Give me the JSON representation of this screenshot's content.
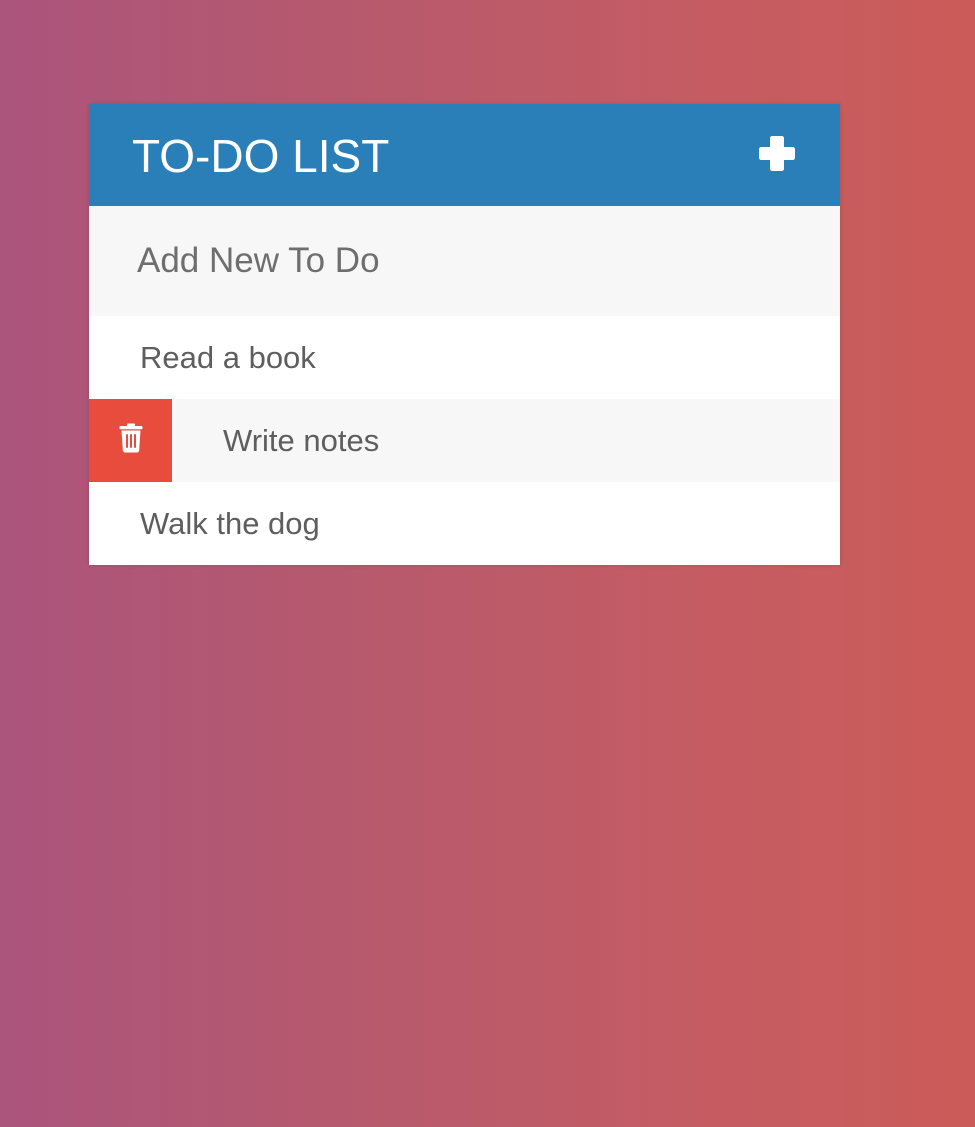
{
  "header": {
    "title": "TO-DO LIST",
    "add_icon": "plus-icon"
  },
  "new_todo": {
    "placeholder": "Add New To Do",
    "value": ""
  },
  "todos": [
    {
      "text": "Read a book",
      "delete_revealed": false
    },
    {
      "text": "Write notes",
      "delete_revealed": true,
      "delete_icon": "trash-icon"
    },
    {
      "text": "Walk the dog",
      "delete_revealed": false
    }
  ],
  "colors": {
    "header_background": "#2a7fb8",
    "delete_background": "#e74c3c",
    "input_background": "#f7f7f7",
    "page_gradient_start": "#ab547c",
    "page_gradient_end": "#cb5b58"
  }
}
